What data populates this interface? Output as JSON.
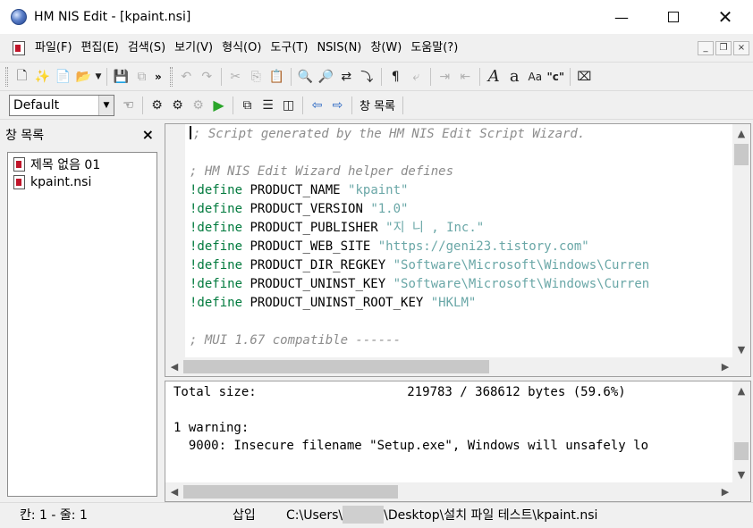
{
  "window": {
    "title": "HM NIS Edit - [kpaint.nsi]"
  },
  "menu": {
    "items": [
      "파일(F)",
      "편집(E)",
      "검색(S)",
      "보기(V)",
      "형식(O)",
      "도구(T)",
      "NSIS(N)",
      "창(W)",
      "도움말(?)"
    ]
  },
  "toolbar": {
    "config_value": "Default",
    "window_list_label": "창 목록"
  },
  "sidebar": {
    "title": "창 목록",
    "close_symbol": "×",
    "items": [
      {
        "label": "제목 없음 01"
      },
      {
        "label": "kpaint.nsi"
      }
    ]
  },
  "editor": {
    "lines": [
      {
        "type": "comment",
        "text": "; Script generated by the HM NIS Edit Script Wizard."
      },
      {
        "type": "blank",
        "text": ""
      },
      {
        "type": "comment",
        "text": "; HM NIS Edit Wizard helper defines"
      },
      {
        "type": "define",
        "kw": "!define",
        "name": "PRODUCT_NAME",
        "value": "\"kpaint\""
      },
      {
        "type": "define",
        "kw": "!define",
        "name": "PRODUCT_VERSION",
        "value": "\"1.0\""
      },
      {
        "type": "define",
        "kw": "!define",
        "name": "PRODUCT_PUBLISHER",
        "value": "\"지 니 , Inc.\""
      },
      {
        "type": "define",
        "kw": "!define",
        "name": "PRODUCT_WEB_SITE",
        "value": "\"https://geni23.tistory.com\""
      },
      {
        "type": "define",
        "kw": "!define",
        "name": "PRODUCT_DIR_REGKEY",
        "value": "\"Software\\Microsoft\\Windows\\Curren"
      },
      {
        "type": "define",
        "kw": "!define",
        "name": "PRODUCT_UNINST_KEY",
        "value": "\"Software\\Microsoft\\Windows\\Curren"
      },
      {
        "type": "define",
        "kw": "!define",
        "name": "PRODUCT_UNINST_ROOT_KEY",
        "value": "\"HKLM\""
      },
      {
        "type": "blank",
        "text": ""
      },
      {
        "type": "comment",
        "text": "; MUI 1.67 compatible ------"
      }
    ]
  },
  "output": {
    "lines": [
      "Total size:                    219783 / 368612 bytes (59.6%)",
      "",
      "1 warning:",
      "  9000: Insecure filename \"Setup.exe\", Windows will unsafely lo"
    ]
  },
  "status": {
    "position": "칸: 1 - 줄: 1",
    "mode": "삽입",
    "path_prefix": "C:\\Users\\",
    "path_suffix": "\\Desktop\\설치 파일 테스트\\kpaint.nsi"
  }
}
